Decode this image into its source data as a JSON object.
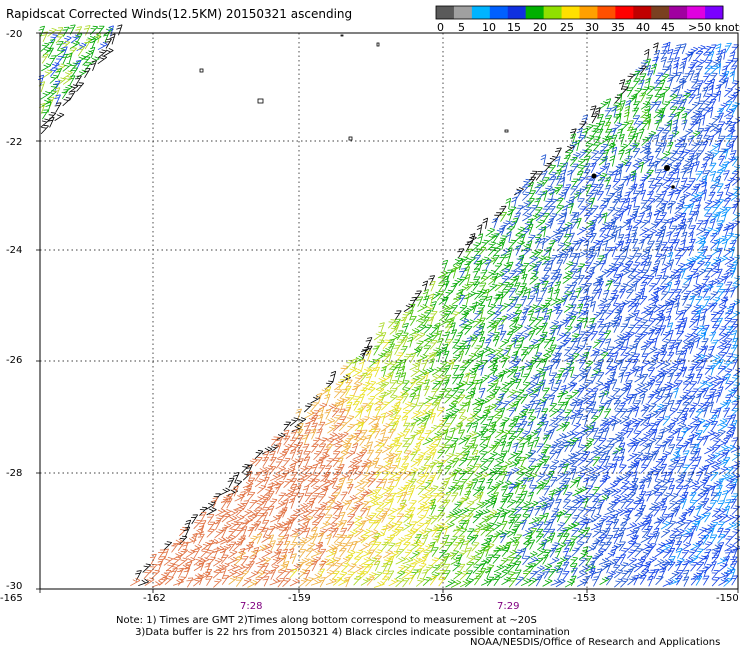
{
  "title": "Rapidscat Corrected Winds(12.5KM) 20150321 ascending",
  "colorbar": {
    "colors": [
      "#5a5a5a",
      "#a0a0a0",
      "#00b4ff",
      "#0060ff",
      "#1030e0",
      "#00b000",
      "#90e000",
      "#ffe000",
      "#ffa000",
      "#ff5000",
      "#ff0000",
      "#c00000",
      "#7a4020",
      "#a000a0",
      "#e000e0",
      "#7a00ff"
    ],
    "labels": [
      "0",
      "5",
      "10",
      "15",
      "20",
      "25",
      "30",
      "35",
      "40",
      "45",
      ">50 knots"
    ]
  },
  "axes": {
    "y_labels": [
      "-20",
      "-22",
      "-24",
      "-26",
      "-28",
      "-30"
    ],
    "x_labels": [
      "-165",
      "-162",
      "-159",
      "-156",
      "-153",
      "-150"
    ],
    "time_labels": [
      "7:28",
      "7:29"
    ],
    "time_color": "#800080"
  },
  "map": {
    "lon_range": [
      -165,
      -150
    ],
    "lat_range": [
      -30,
      -20
    ],
    "swath_edge": "ascending diagonal from lower-left to upper-right"
  },
  "notes": {
    "line1": "Note: 1) Times are GMT 2)Times along bottom correspond to measurement at ~20S",
    "line2": "      3)Data buffer is 22 hrs from 20150321 4) Black circles indicate possible contamination"
  },
  "credit": "NOAA/NESDIS/Office of Research and Applications"
}
